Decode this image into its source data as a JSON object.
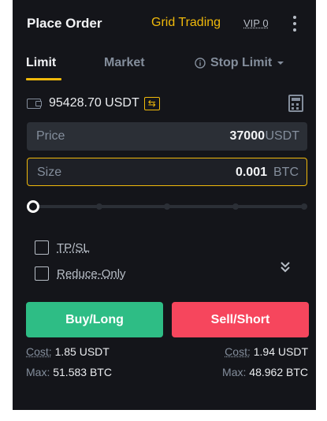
{
  "header": {
    "title": "Place Order",
    "grid_trading": "Grid Trading",
    "vip": "VIP 0"
  },
  "tabs": [
    {
      "label": "Limit",
      "active": true
    },
    {
      "label": "Market",
      "active": false
    },
    {
      "label": "Stop Limit",
      "active": false
    }
  ],
  "balance": {
    "value": "95428.70 USDT"
  },
  "price": {
    "label": "Price",
    "value": "37000",
    "unit": "USDT"
  },
  "size": {
    "label": "Size",
    "value": "0.001",
    "unit": "BTC"
  },
  "slider": {
    "percent": 0
  },
  "options": {
    "tpsl": "TP/SL",
    "reduce_only": "Reduce-Only"
  },
  "buttons": {
    "buy": "Buy/Long",
    "sell": "Sell/Short"
  },
  "buy_info": {
    "cost_label": "Cost:",
    "cost_value": "1.85 USDT",
    "max_label": "Max:",
    "max_value": "51.583 BTC"
  },
  "sell_info": {
    "cost_label": "Cost:",
    "cost_value": "1.94 USDT",
    "max_label": "Max:",
    "max_value": "48.962 BTC"
  },
  "colors": {
    "accent": "#f0b90b",
    "buy": "#2ebd85",
    "sell": "#f6465d",
    "background": "#14151a"
  }
}
